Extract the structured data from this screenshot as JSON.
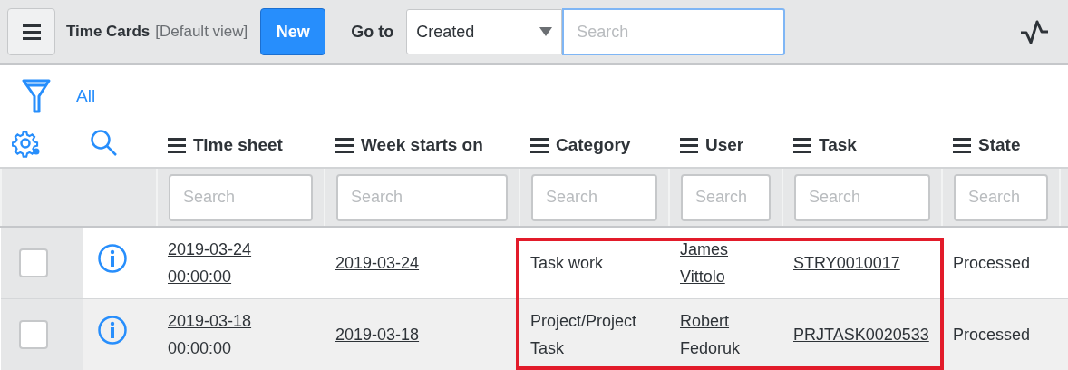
{
  "header": {
    "title": "Time Cards",
    "view": "[Default view]",
    "new_button": "New",
    "goto_label": "Go to",
    "goto_select": "Created",
    "search": {
      "placeholder": "Search"
    }
  },
  "filter": {
    "label": "All"
  },
  "table": {
    "columns": [
      {
        "label": "Time sheet",
        "placeholder": "Search",
        "highlighted": false
      },
      {
        "label": "Week starts on",
        "placeholder": "Search",
        "highlighted": false
      },
      {
        "label": "Category",
        "placeholder": "Search",
        "highlighted": true
      },
      {
        "label": "User",
        "placeholder": "Search",
        "highlighted": true
      },
      {
        "label": "Task",
        "placeholder": "Search",
        "highlighted": true
      },
      {
        "label": "State",
        "placeholder": "Search",
        "highlighted": false
      }
    ],
    "rows": [
      {
        "checked": false,
        "cells": [
          {
            "text": "2019-03-24 00:00:00",
            "kind": "link"
          },
          {
            "text": "2019-03-24",
            "kind": "link"
          },
          {
            "text": "Task work",
            "kind": "text"
          },
          {
            "text": "James Vittolo",
            "kind": "link"
          },
          {
            "text": "STRY0010017",
            "kind": "link"
          },
          {
            "text": "Processed",
            "kind": "text"
          }
        ]
      },
      {
        "checked": false,
        "cells": [
          {
            "text": "2019-03-18 00:00:00",
            "kind": "link"
          },
          {
            "text": "2019-03-18",
            "kind": "link"
          },
          {
            "text": "Project/Project Task",
            "kind": "text"
          },
          {
            "text": "Robert Fedoruk",
            "kind": "link"
          },
          {
            "text": "PRJTASK0020533",
            "kind": "link"
          },
          {
            "text": "Processed",
            "kind": "text"
          }
        ]
      }
    ]
  }
}
